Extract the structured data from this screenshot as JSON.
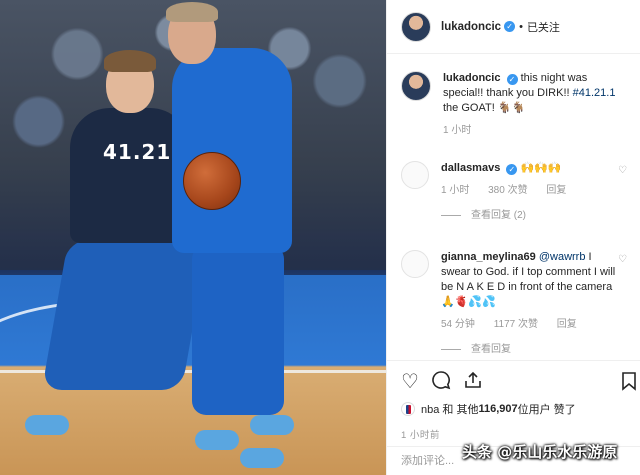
{
  "photo": {
    "jersey_number": "41.21.1"
  },
  "header": {
    "username": "lukadoncic",
    "separator": "•",
    "follow_status": "已关注"
  },
  "caption": {
    "username": "lukadoncic",
    "text_before": "this night was special!! thank you DIRK!! ",
    "hashtag": "#41.21.1",
    "text_after": " the GOAT! 🐐🐐",
    "time": "1 小时"
  },
  "comments": [
    {
      "username": "dallasmavs",
      "text": "🙌🙌🙌",
      "time": "1 小时",
      "likes": "380 次赞",
      "reply_label": "回复",
      "view_replies": "查看回复 (2)"
    },
    {
      "username": "gianna_meylina69",
      "mention": "@wawrrb",
      "text": " I swear to God. if I top comment I will be N A K E D in front of the camera 🙏🫀💦💦",
      "time": "54 分钟",
      "likes": "1177 次赞",
      "reply_label": "回复",
      "view_replies": "查看回复"
    }
  ],
  "actions": {
    "like_icon": "heart-outline-icon",
    "comment_icon": "comment-bubble-icon",
    "share_icon": "share-icon",
    "save_icon": "bookmark-icon",
    "likes_text_prefix": "nba 和 其他 ",
    "likes_count": "116,907",
    "likes_text_suffix": " 位用户 赞了",
    "post_time": "1 小时前"
  },
  "add_comment": {
    "placeholder": "添加评论..."
  },
  "watermark": "头条 @乐山乐水乐游原",
  "colors": {
    "verified": "#3897f0",
    "link": "#003569",
    "meta": "#999999"
  }
}
